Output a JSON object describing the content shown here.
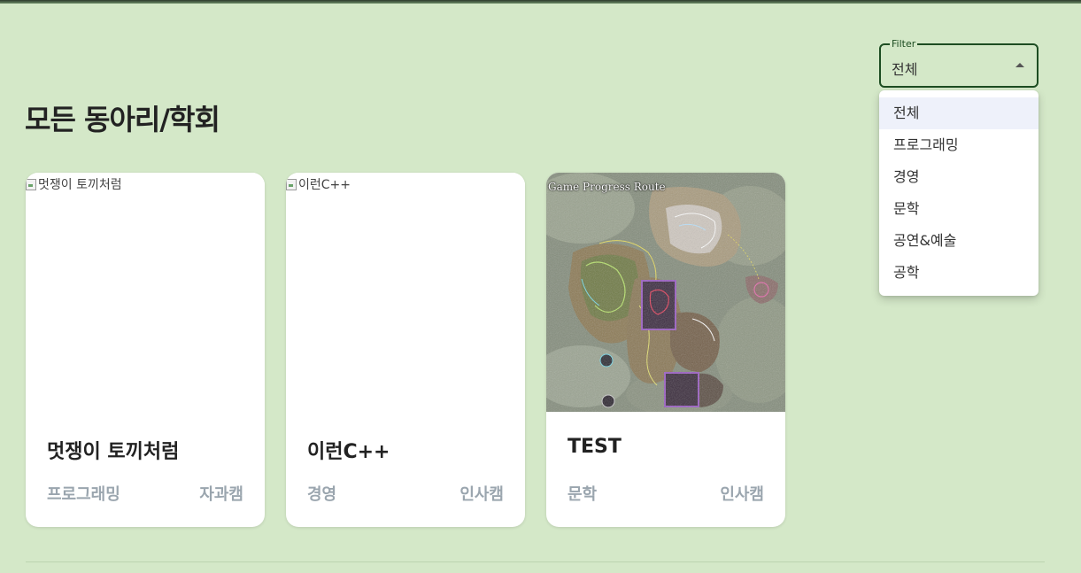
{
  "page": {
    "title": "모든 동아리/학회"
  },
  "filter": {
    "label": "Filter",
    "value": "전체",
    "options": [
      "전체",
      "프로그래밍",
      "경영",
      "문학",
      "공연&예술",
      "공학"
    ]
  },
  "cards": [
    {
      "image_alt": "멋쟁이 토끼처럼",
      "name": "멋쟁이 토끼처럼",
      "category": "프로그래밍",
      "campus": "자과캠"
    },
    {
      "image_alt": "이런C++",
      "name": "이런C++",
      "category": "경영",
      "campus": "인사캠"
    },
    {
      "image_caption": "Game Progress Route",
      "name": "TEST",
      "category": "문학",
      "campus": "인사캠"
    }
  ],
  "colors": {
    "background": "#d4e8c8",
    "accent": "#1d4d22",
    "muted_text": "#9aa5ae"
  }
}
